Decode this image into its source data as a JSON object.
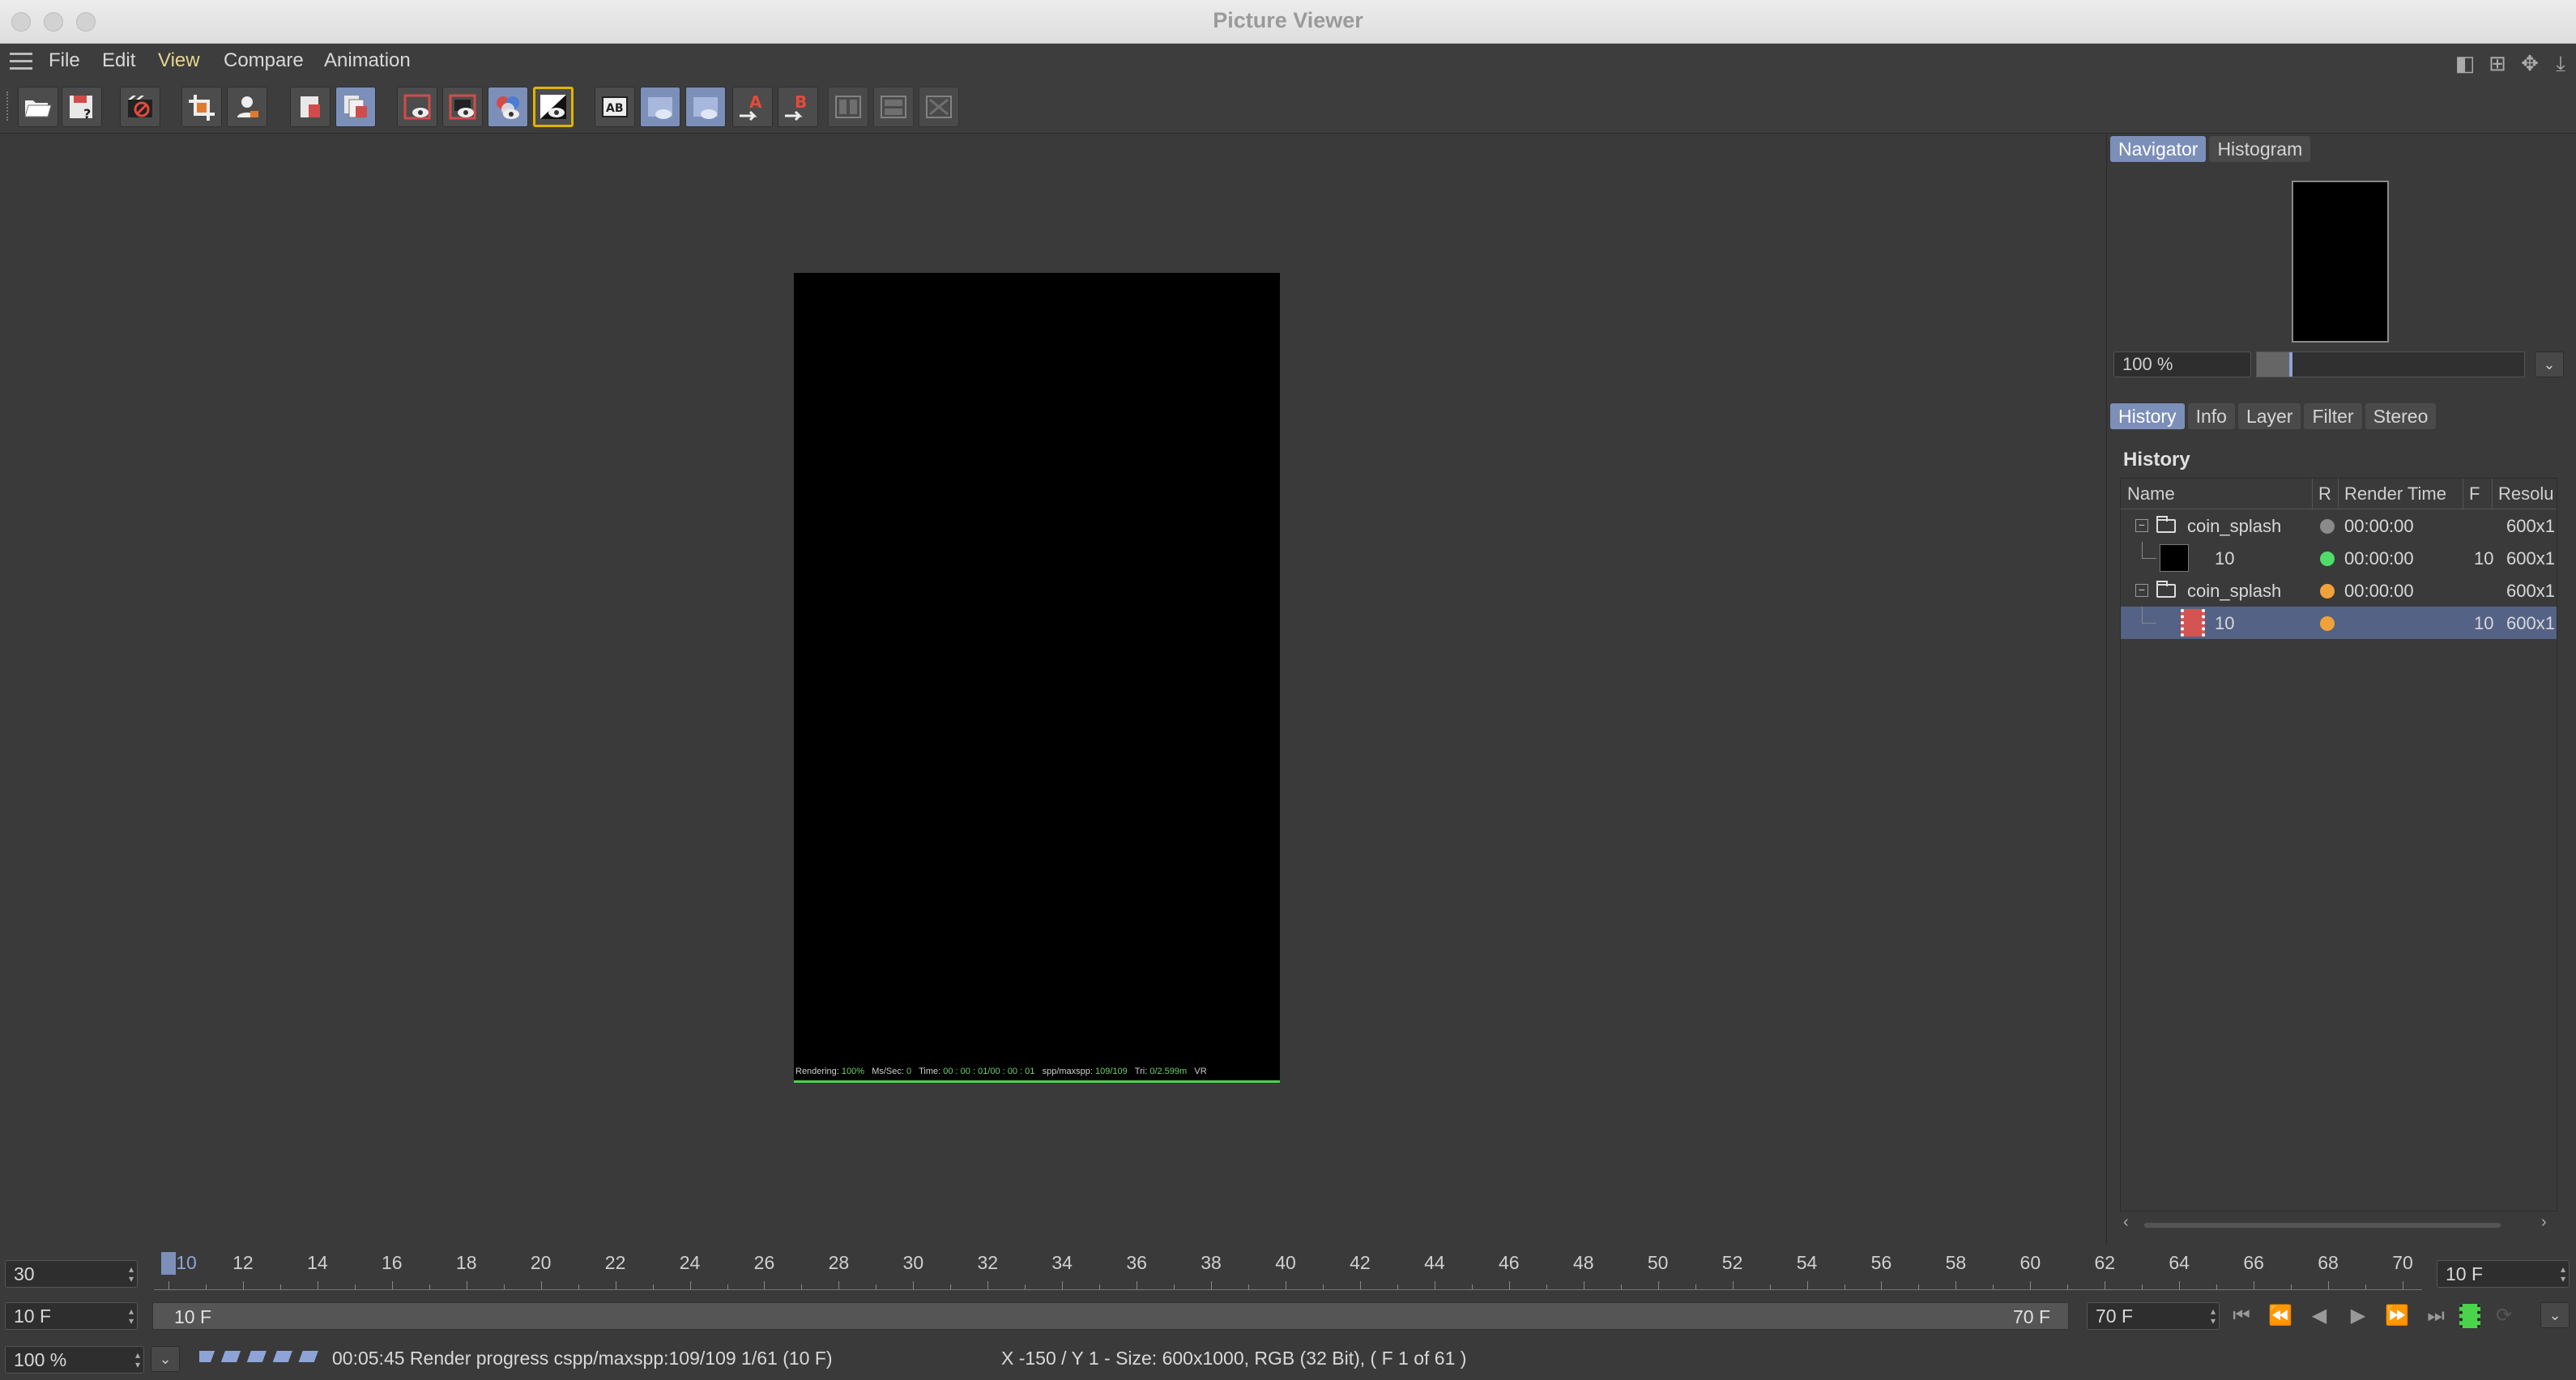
{
  "window": {
    "title": "Picture Viewer"
  },
  "menu": {
    "items": [
      "File",
      "Edit",
      "View",
      "Compare",
      "Animation"
    ]
  },
  "toolbar": {
    "buttons": [
      "open-icon",
      "save-icon",
      "stop-render-icon",
      "crop-icon",
      "user-icon",
      "delete-icon",
      "remove-all-icon",
      "eye-a-icon",
      "eye-b-icon",
      "eye-c-icon",
      "eye-d-icon",
      "ab-icon",
      "ab-compare-icon",
      "ab-compare-2-icon",
      "set-a-icon",
      "set-b-icon",
      "layout-1-icon",
      "layout-2-icon",
      "layout-3-icon"
    ],
    "set_a_label": "A",
    "set_b_label": "B",
    "ab_label": "AB"
  },
  "image": {
    "overlay": {
      "rendering_label": "Rendering:",
      "rendering_value": "100%",
      "ms_label": "Ms/Sec:",
      "ms_value": "0",
      "time_label": "Time:",
      "time_value": "00 : 00 : 01/00 : 00 : 01",
      "spp_label": "spp/maxspp:",
      "spp_value": "109/109",
      "tri_label": "Tri:",
      "tri_value": "0/2.599m",
      "vr_label": "VR"
    }
  },
  "navigator": {
    "tabs": [
      "Navigator",
      "Histogram"
    ],
    "zoom": "100 %",
    "zoom_fraction": 0.12
  },
  "info_tabs": [
    "History",
    "Info",
    "Layer",
    "Filter",
    "Stereo"
  ],
  "history": {
    "title": "History",
    "columns": {
      "name": "Name",
      "r": "R",
      "render_time": "Render Time",
      "f": "F",
      "resolution": "Resolu"
    },
    "rows": [
      {
        "name": "coin_splash",
        "status_color": "#8a8a8a",
        "render_time": "00:00:00",
        "f": "",
        "resolution": "600x1"
      },
      {
        "name": "10",
        "status_color": "#4fdc6b",
        "render_time": "00:00:00",
        "f": "10",
        "resolution": "600x1"
      },
      {
        "name": "coin_splash",
        "status_color": "#f0a23a",
        "render_time": "00:00:00",
        "f": "",
        "resolution": "600x1"
      },
      {
        "name": "10",
        "status_color": "#f0a23a",
        "render_time": "",
        "f": "10",
        "resolution": "600x1"
      }
    ]
  },
  "timeline": {
    "fps": "30",
    "end_field": "10 F",
    "start_field": "10 F",
    "range_start": "10 F",
    "range_end": "70 F",
    "max_field": "70 F",
    "current": "10",
    "ticks": [
      "12",
      "14",
      "16",
      "18",
      "20",
      "22",
      "24",
      "26",
      "28",
      "30",
      "32",
      "34",
      "36",
      "38",
      "40",
      "42",
      "44",
      "46",
      "48",
      "50",
      "52",
      "54",
      "56",
      "58",
      "60",
      "62",
      "64",
      "66",
      "68",
      "70"
    ]
  },
  "status": {
    "zoom": "100 %",
    "progress_text": "00:05:45 Render progress  cspp/maxspp:109/109 1/61 (10 F)",
    "info_text": "X -150 / Y 1 - Size: 600x1000, RGB (32 Bit),  ( F 1 of 61 )"
  },
  "colors": {
    "accent": "#7c8fb9",
    "active_menu": "#e6d690",
    "render_line": "#4bd34b"
  }
}
